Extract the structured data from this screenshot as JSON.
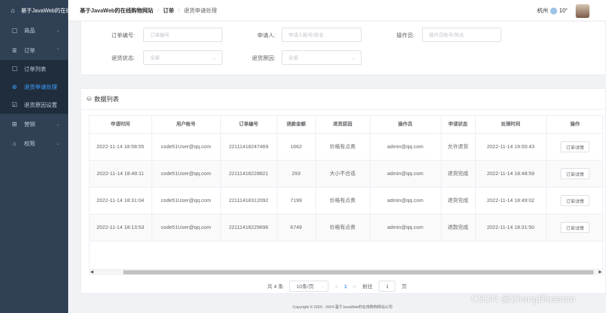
{
  "sidebar": {
    "items": [
      {
        "icon": "home-icon",
        "label": "基于JavaWeb的在线购物网站",
        "chevron": ""
      },
      {
        "icon": "goods-icon",
        "label": "商品",
        "chevron": "⌄"
      },
      {
        "icon": "order-icon",
        "label": "订单",
        "chevron": "⌃"
      },
      {
        "icon": "order-list-icon",
        "label": "订单列表",
        "chevron": ""
      },
      {
        "icon": "return-apply-icon",
        "label": "退货申请处理",
        "chevron": ""
      },
      {
        "icon": "return-reason-icon",
        "label": "退货原因设置",
        "chevron": ""
      },
      {
        "icon": "marketing-icon",
        "label": "营销",
        "chevron": "⌄"
      },
      {
        "icon": "permission-icon",
        "label": "权限",
        "chevron": "⌄"
      }
    ]
  },
  "header": {
    "breadcrumb": {
      "site": "基于JavaWeb的在线购物网站",
      "sep": "/",
      "section": "订单",
      "current": "退货申请处理"
    },
    "city": "杭州",
    "temperature": "10°"
  },
  "search": {
    "order_no_label": "订单编号:",
    "order_no_placeholder": "订单编号",
    "applicant_label": "申请人:",
    "applicant_placeholder": "申请人帐号/姓名",
    "operator_label": "操作员:",
    "operator_placeholder": "操作员帐号/姓名",
    "status_label": "退货状态:",
    "status_value": "全部",
    "reason_label": "退货原因:",
    "reason_value": "全部"
  },
  "list": {
    "title": "数据列表",
    "columns": [
      "申请时间",
      "用户帐号",
      "订单编号",
      "退款金额",
      "退货原因",
      "操作员",
      "申请状态",
      "处理时间",
      "操作"
    ],
    "rows": [
      {
        "apply_time": "2022-11-14 18:58:55",
        "account": "code51User@qq.com",
        "order_no": "22111418247469",
        "amount": "1662",
        "reason": "价格有点贵",
        "operator": "admin@qq.com",
        "status": "允许退货",
        "handle_time": "2022-11-14 19:00:43",
        "action": "订单详情"
      },
      {
        "apply_time": "2022-11-14 18:48:11",
        "account": "code51User@qq.com",
        "order_no": "22111418228821",
        "amount": "293",
        "reason": "大小不合适",
        "operator": "admin@qq.com",
        "status": "退货完成",
        "handle_time": "2022-11-14 18:48:59",
        "action": "订单详情"
      },
      {
        "apply_time": "2022-11-14 18:31:04",
        "account": "code51User@qq.com",
        "order_no": "22111418312092",
        "amount": "7199",
        "reason": "价格有点贵",
        "operator": "admin@qq.com",
        "status": "退货完成",
        "handle_time": "2022-11-14 18:49:02",
        "action": "订单详情"
      },
      {
        "apply_time": "2022-11-14 18:13:53",
        "account": "code51User@qq.com",
        "order_no": "22111418229696",
        "amount": "6749",
        "reason": "价格有点贵",
        "operator": "admin@qq.com",
        "status": "退款完成",
        "handle_time": "2022-11-14 18:31:50",
        "action": "订单详情"
      }
    ]
  },
  "pagination": {
    "total": "共 4 条",
    "page_size": "10条/页",
    "prev": "<",
    "current_page": "1",
    "next": ">",
    "goto_label": "前往",
    "goto_value": "1",
    "page_unit": "页"
  },
  "footer": {
    "copyright": "Copyright © 2020 - 2024  基于JavaWeb的在线购物网站公司"
  },
  "watermark": "CSDN @ZhangBlossom",
  "colors": {
    "sidebar_bg": "#304156",
    "sidebar_sub_bg": "#1f2d3d",
    "accent": "#409eff"
  }
}
